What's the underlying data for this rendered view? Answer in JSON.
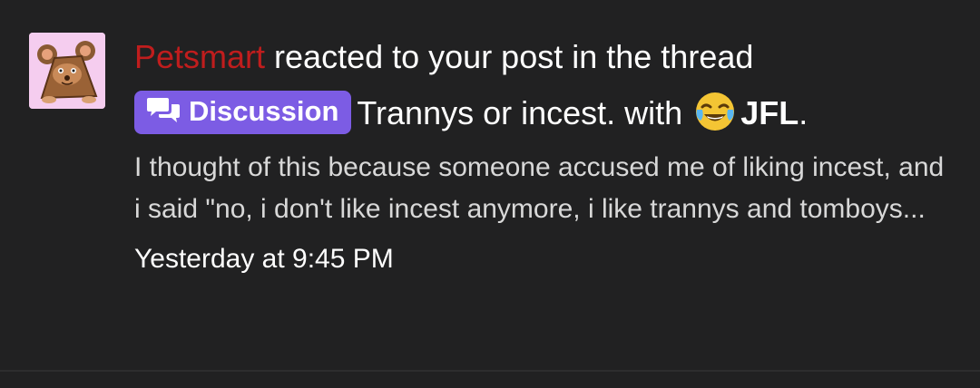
{
  "alert": {
    "username": "Petsmart",
    "action_text": " reacted to your post in the thread ",
    "prefix_label": "Discussion",
    "thread_title": "Trannys or incest.",
    "with_text": " with ",
    "reaction_emoji": "crying-laughing-emoji",
    "reaction_name": "JFL",
    "end_punct": ".",
    "snippet": "I thought of this because someone accused me of liking incest, and i said \"no, i don't like incest anymore, i like trannys and tomboys...",
    "time": "Yesterday at 9:45 PM"
  },
  "colors": {
    "background": "#212122",
    "username": "#c01d1d",
    "label_bg": "#7c5ce4",
    "avatar_bg": "#f5cdef"
  }
}
